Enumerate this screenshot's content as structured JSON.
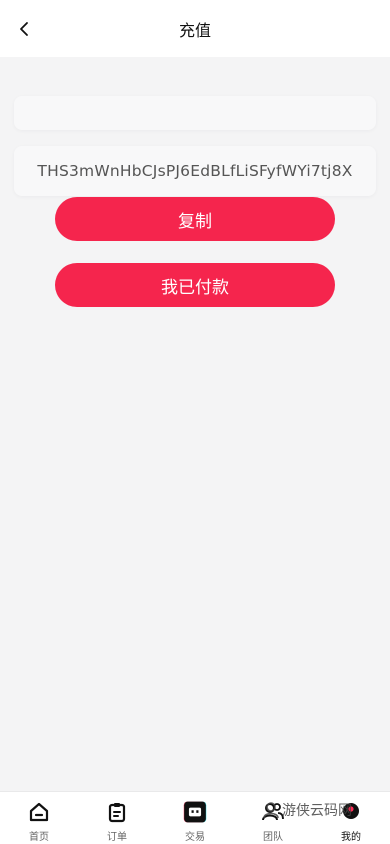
{
  "header": {
    "title": "充值",
    "back_icon": "chevron-left-icon"
  },
  "wallet": {
    "top_field_value": "",
    "address": "THS3mWnHbCJsPJ6EdBLfLiSFyfWYi7tj8X"
  },
  "actions": {
    "copy_label": "复制",
    "paid_label": "我已付款",
    "button_color": "#f5254d"
  },
  "tabbar": {
    "items": [
      {
        "label": "首页",
        "icon": "home-icon"
      },
      {
        "label": "订单",
        "icon": "clipboard-icon"
      },
      {
        "label": "交易",
        "icon": "robot-icon"
      },
      {
        "label": "团队",
        "icon": "team-icon"
      },
      {
        "label": "我的",
        "icon": "profile-icon"
      }
    ],
    "active_index": 4
  },
  "watermark": {
    "text": "游侠云码网"
  }
}
